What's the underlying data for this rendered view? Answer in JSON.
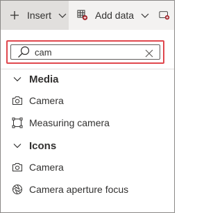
{
  "toolbar": {
    "insert_label": "Insert",
    "add_data_label": "Add data"
  },
  "search": {
    "value": "cam"
  },
  "groups": [
    {
      "title": "Media",
      "items": [
        {
          "label": "Camera",
          "icon": "camera-icon"
        },
        {
          "label": "Measuring camera",
          "icon": "measuring-camera-icon"
        }
      ]
    },
    {
      "title": "Icons",
      "items": [
        {
          "label": "Camera",
          "icon": "camera-icon"
        },
        {
          "label": "Camera aperture focus",
          "icon": "camera-aperture-icon"
        }
      ]
    }
  ],
  "colors": {
    "highlight_border": "#e0474d",
    "toolbar_bg": "#f3f2f1",
    "insert_active_bg": "#e1dfdd",
    "add_data_icon_accent": "#a4262c"
  }
}
